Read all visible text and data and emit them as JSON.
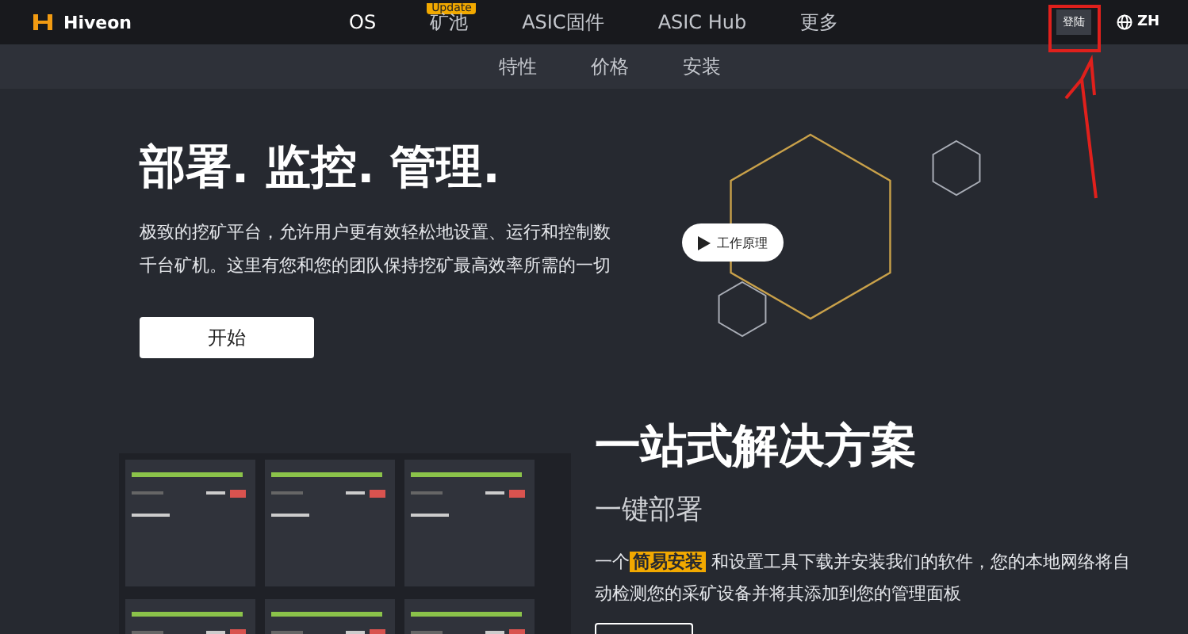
{
  "header": {
    "logo": "Hiveon",
    "nav": [
      {
        "label": "OS",
        "selected": true
      },
      {
        "label": "矿池",
        "selected": false,
        "badge": "Update"
      },
      {
        "label": "ASIC固件",
        "selected": false
      },
      {
        "label": "ASIC Hub",
        "selected": false
      },
      {
        "label": "更多",
        "selected": false
      }
    ],
    "login": "登陆",
    "language": "ZH"
  },
  "subnav": [
    "特性",
    "价格",
    "安装"
  ],
  "hero": {
    "title": "部署. 监控. 管理.",
    "text": "极致的挖矿平台，允许用户更有效轻松地设置、运行和控制数千台矿机。这里有您和您的团队保持挖矿最高效率所需的一切",
    "button": "开始",
    "video_button": "工作原理"
  },
  "solution": {
    "title": "一站式解决方案",
    "subtitle": "一键部署",
    "text": "一个**简易安装** 和设置工具下载并安装我们的软件，您的本地网络将自动检测您的采矿设备并将其添加到您的管理面板"
  }
}
